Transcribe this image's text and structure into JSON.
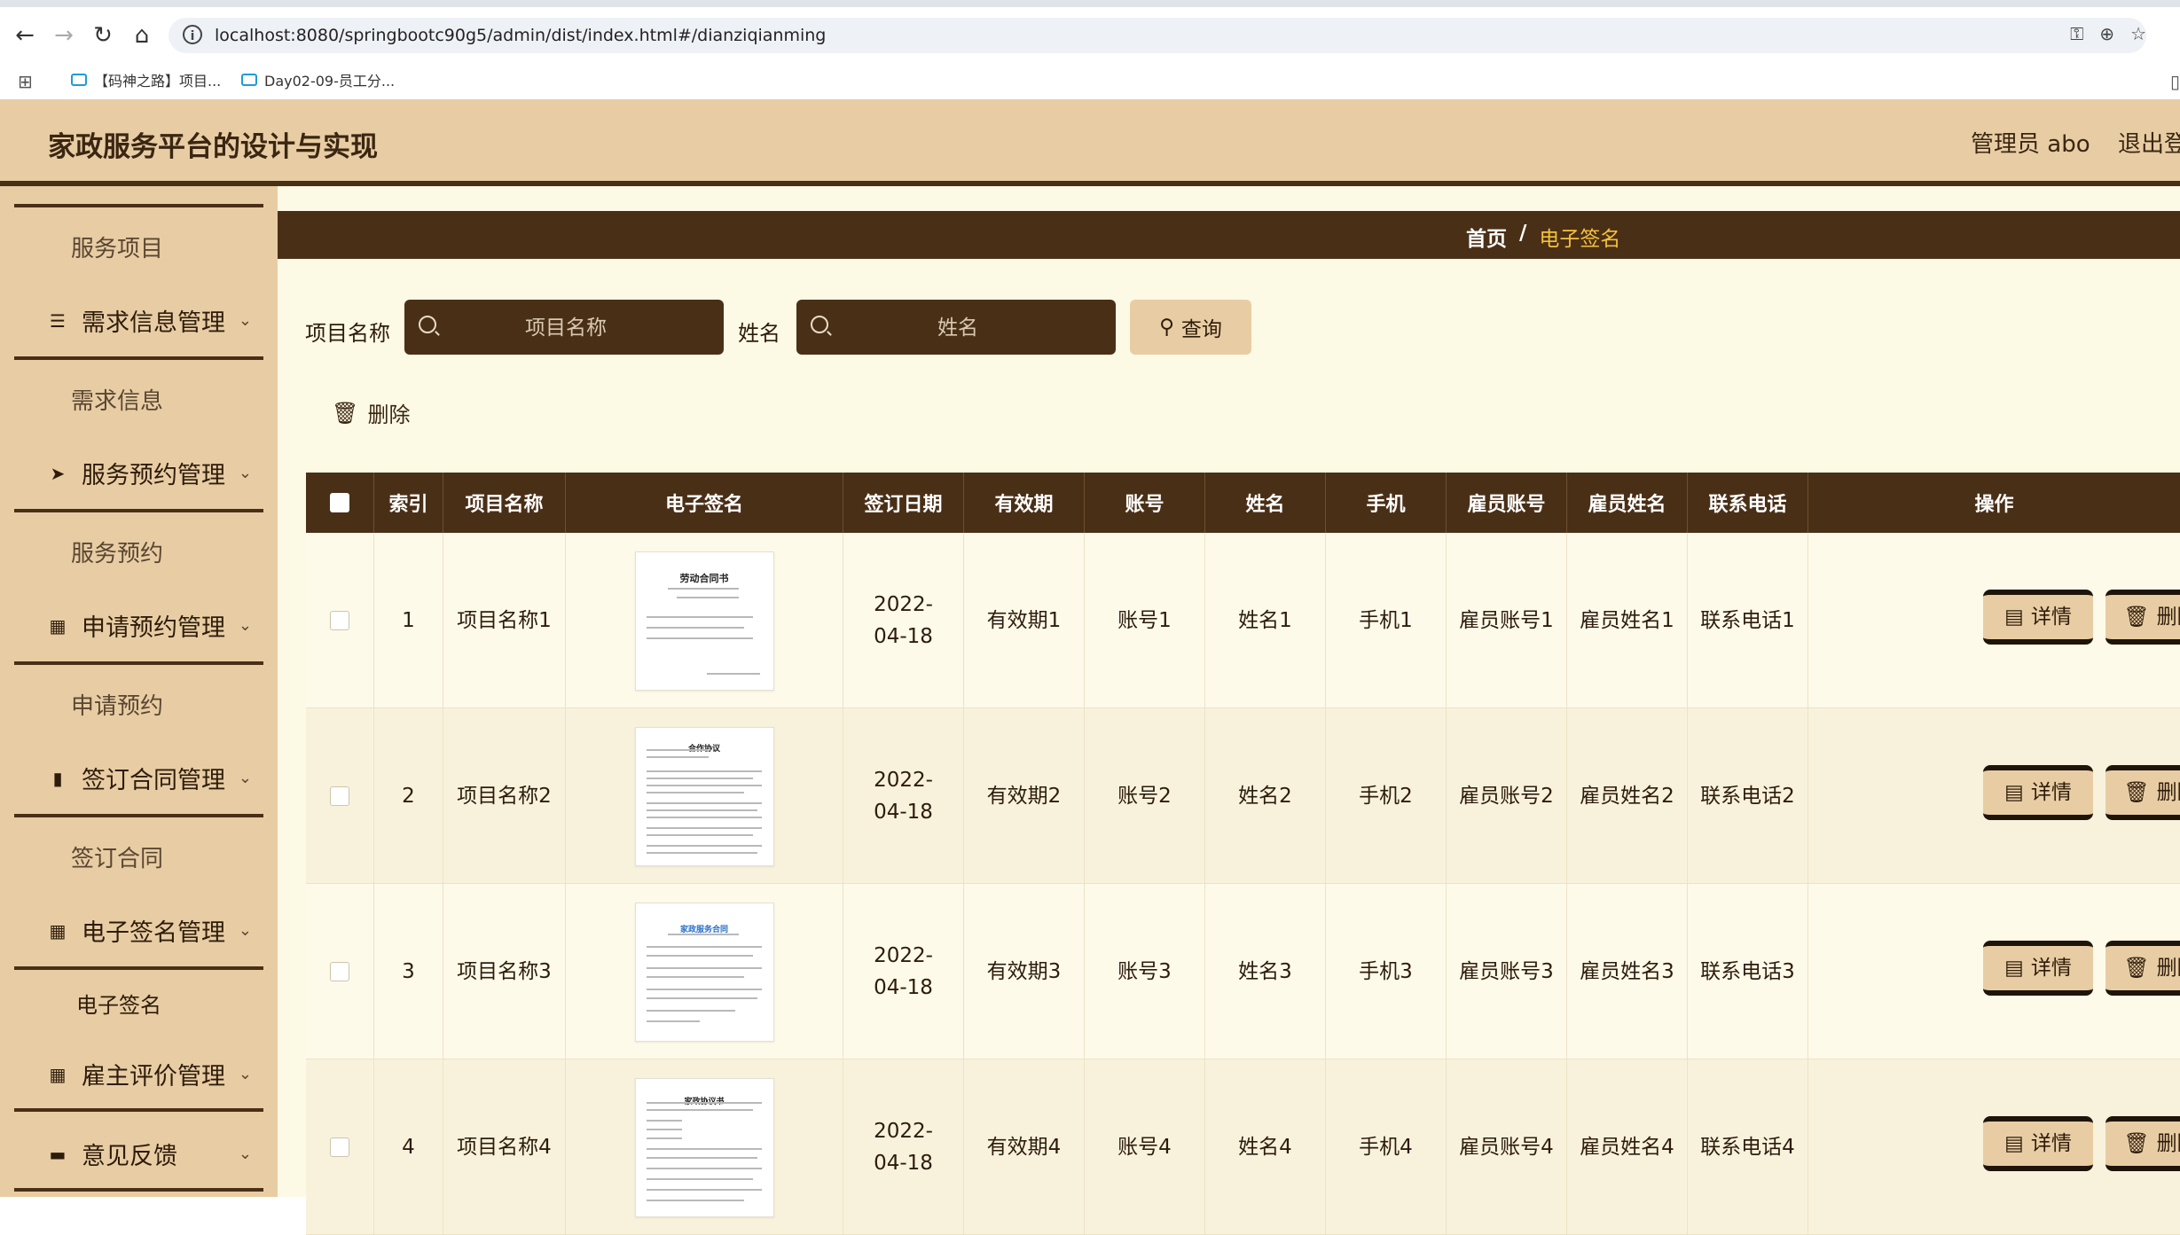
{
  "browser": {
    "url": "localhost:8080/springbootc90g5/admin/dist/index.html#/dianziqianming",
    "bookmarks": [
      "【码神之路】项目...",
      "Day02-09-员工分..."
    ]
  },
  "header": {
    "title": "家政服务平台的设计与实现",
    "user": "管理员 abo",
    "logout": "退出登"
  },
  "sidebar": {
    "items": [
      {
        "type": "item",
        "label": "服务项目"
      },
      {
        "type": "group",
        "label": "需求信息管理",
        "icon": "list-icon"
      },
      {
        "type": "item",
        "label": "需求信息"
      },
      {
        "type": "group",
        "label": "服务预约管理",
        "icon": "send-icon"
      },
      {
        "type": "item",
        "label": "服务预约"
      },
      {
        "type": "group",
        "label": "申请预约管理",
        "icon": "grid-icon"
      },
      {
        "type": "item",
        "label": "申请预约"
      },
      {
        "type": "group",
        "label": "签订合同管理",
        "icon": "book-icon"
      },
      {
        "type": "item",
        "label": "签订合同"
      },
      {
        "type": "group",
        "label": "电子签名管理",
        "icon": "grid-icon"
      },
      {
        "type": "item",
        "label": "电子签名",
        "active": true
      },
      {
        "type": "group",
        "label": "雇主评价管理",
        "icon": "grid-icon"
      },
      {
        "type": "group",
        "label": "意见反馈",
        "icon": "monitor-icon"
      }
    ]
  },
  "breadcrumb": {
    "home": "首页",
    "sep": "/",
    "current": "电子签名"
  },
  "filters": {
    "project_label": "项目名称",
    "project_placeholder": "项目名称",
    "name_label": "姓名",
    "name_placeholder": "姓名",
    "query_label": "查询"
  },
  "toolbar": {
    "delete_label": "删除"
  },
  "table": {
    "columns": [
      "索引",
      "项目名称",
      "电子签名",
      "签订日期",
      "有效期",
      "账号",
      "姓名",
      "手机",
      "雇员账号",
      "雇员姓名",
      "联系电话",
      "操作"
    ],
    "rows": [
      {
        "index": "1",
        "project": "项目名称1",
        "doc_title": "劳动合同书",
        "date": "2022-04-18",
        "validity": "有效期1",
        "account": "账号1",
        "name": "姓名1",
        "phone": "手机1",
        "emp_account": "雇员账号1",
        "emp_name": "雇员姓名1",
        "contact": "联系电话1"
      },
      {
        "index": "2",
        "project": "项目名称2",
        "doc_title": "合作协议",
        "date": "2022-04-18",
        "validity": "有效期2",
        "account": "账号2",
        "name": "姓名2",
        "phone": "手机2",
        "emp_account": "雇员账号2",
        "emp_name": "雇员姓名2",
        "contact": "联系电话2"
      },
      {
        "index": "3",
        "project": "项目名称3",
        "doc_title": "家政服务合同",
        "date": "2022-04-18",
        "validity": "有效期3",
        "account": "账号3",
        "name": "姓名3",
        "phone": "手机3",
        "emp_account": "雇员账号3",
        "emp_name": "雇员姓名3",
        "contact": "联系电话3"
      },
      {
        "index": "4",
        "project": "项目名称4",
        "doc_title": "家政协议书",
        "date": "2022-04-18",
        "validity": "有效期4",
        "account": "账号4",
        "name": "姓名4",
        "phone": "手机4",
        "emp_account": "雇员账号4",
        "emp_name": "雇员姓名4",
        "contact": "联系电话4"
      }
    ],
    "detail_label": "详情",
    "delete_label": "删除"
  },
  "colors": {
    "accent": "#4a2f17",
    "panel": "#e8cda4",
    "background": "#fcf9e4",
    "breadcrumb_active": "#f4c23a"
  }
}
